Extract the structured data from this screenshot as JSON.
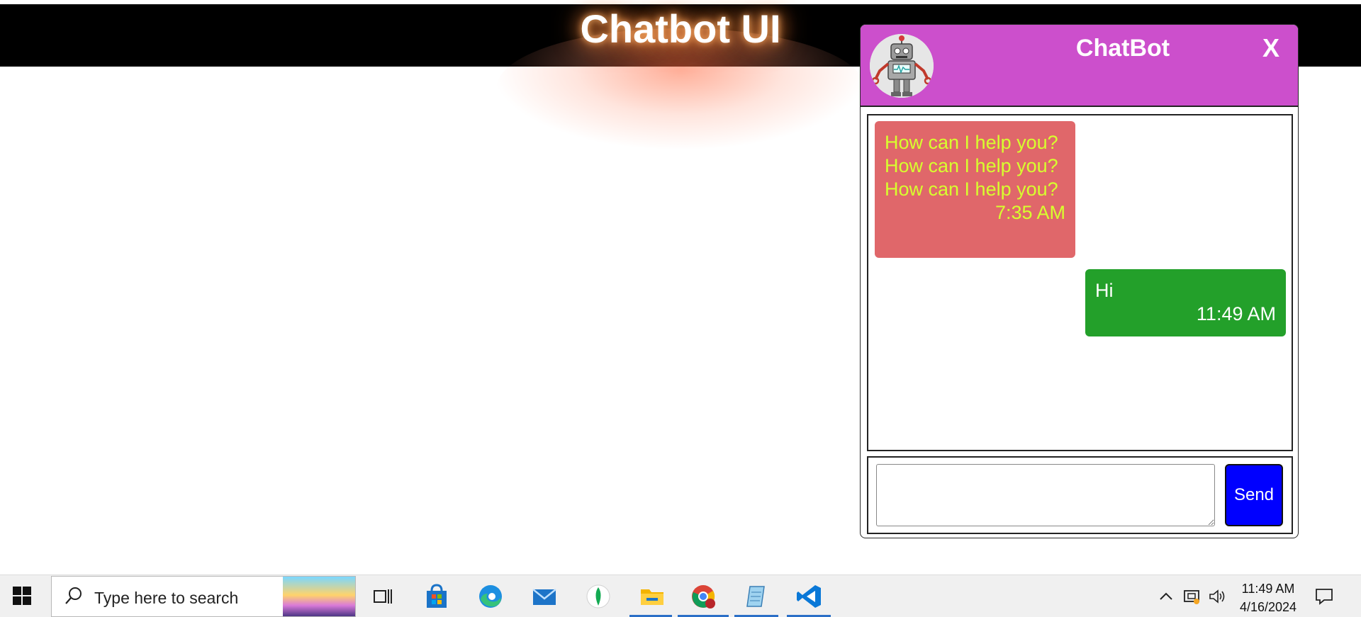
{
  "page": {
    "title": "Chatbot UI"
  },
  "chat": {
    "title": "ChatBot",
    "close_label": "X",
    "messages": [
      {
        "sender": "bot",
        "text": "How can I help you? How can I help you? How can I help you?",
        "time": "7:35 AM"
      },
      {
        "sender": "user",
        "text": "Hi",
        "time": "11:49 AM"
      }
    ],
    "input": {
      "value": "",
      "placeholder": ""
    },
    "send_label": "Send"
  },
  "taskbar": {
    "search_placeholder": "Type here to search",
    "apps": [
      "task-view",
      "microsoft-store",
      "edge",
      "mail",
      "mongodb-compass",
      "file-explorer",
      "chrome",
      "notepad",
      "vscode"
    ],
    "clock": {
      "time": "11:49 AM",
      "date": "4/16/2024"
    }
  },
  "colors": {
    "header_bar": "#000000",
    "chat_header": "#cc4fcc",
    "bot_bubble": "#e0676a",
    "bot_text": "#d7ff2e",
    "user_bubble": "#23a02a",
    "send_button": "#0000ff"
  }
}
